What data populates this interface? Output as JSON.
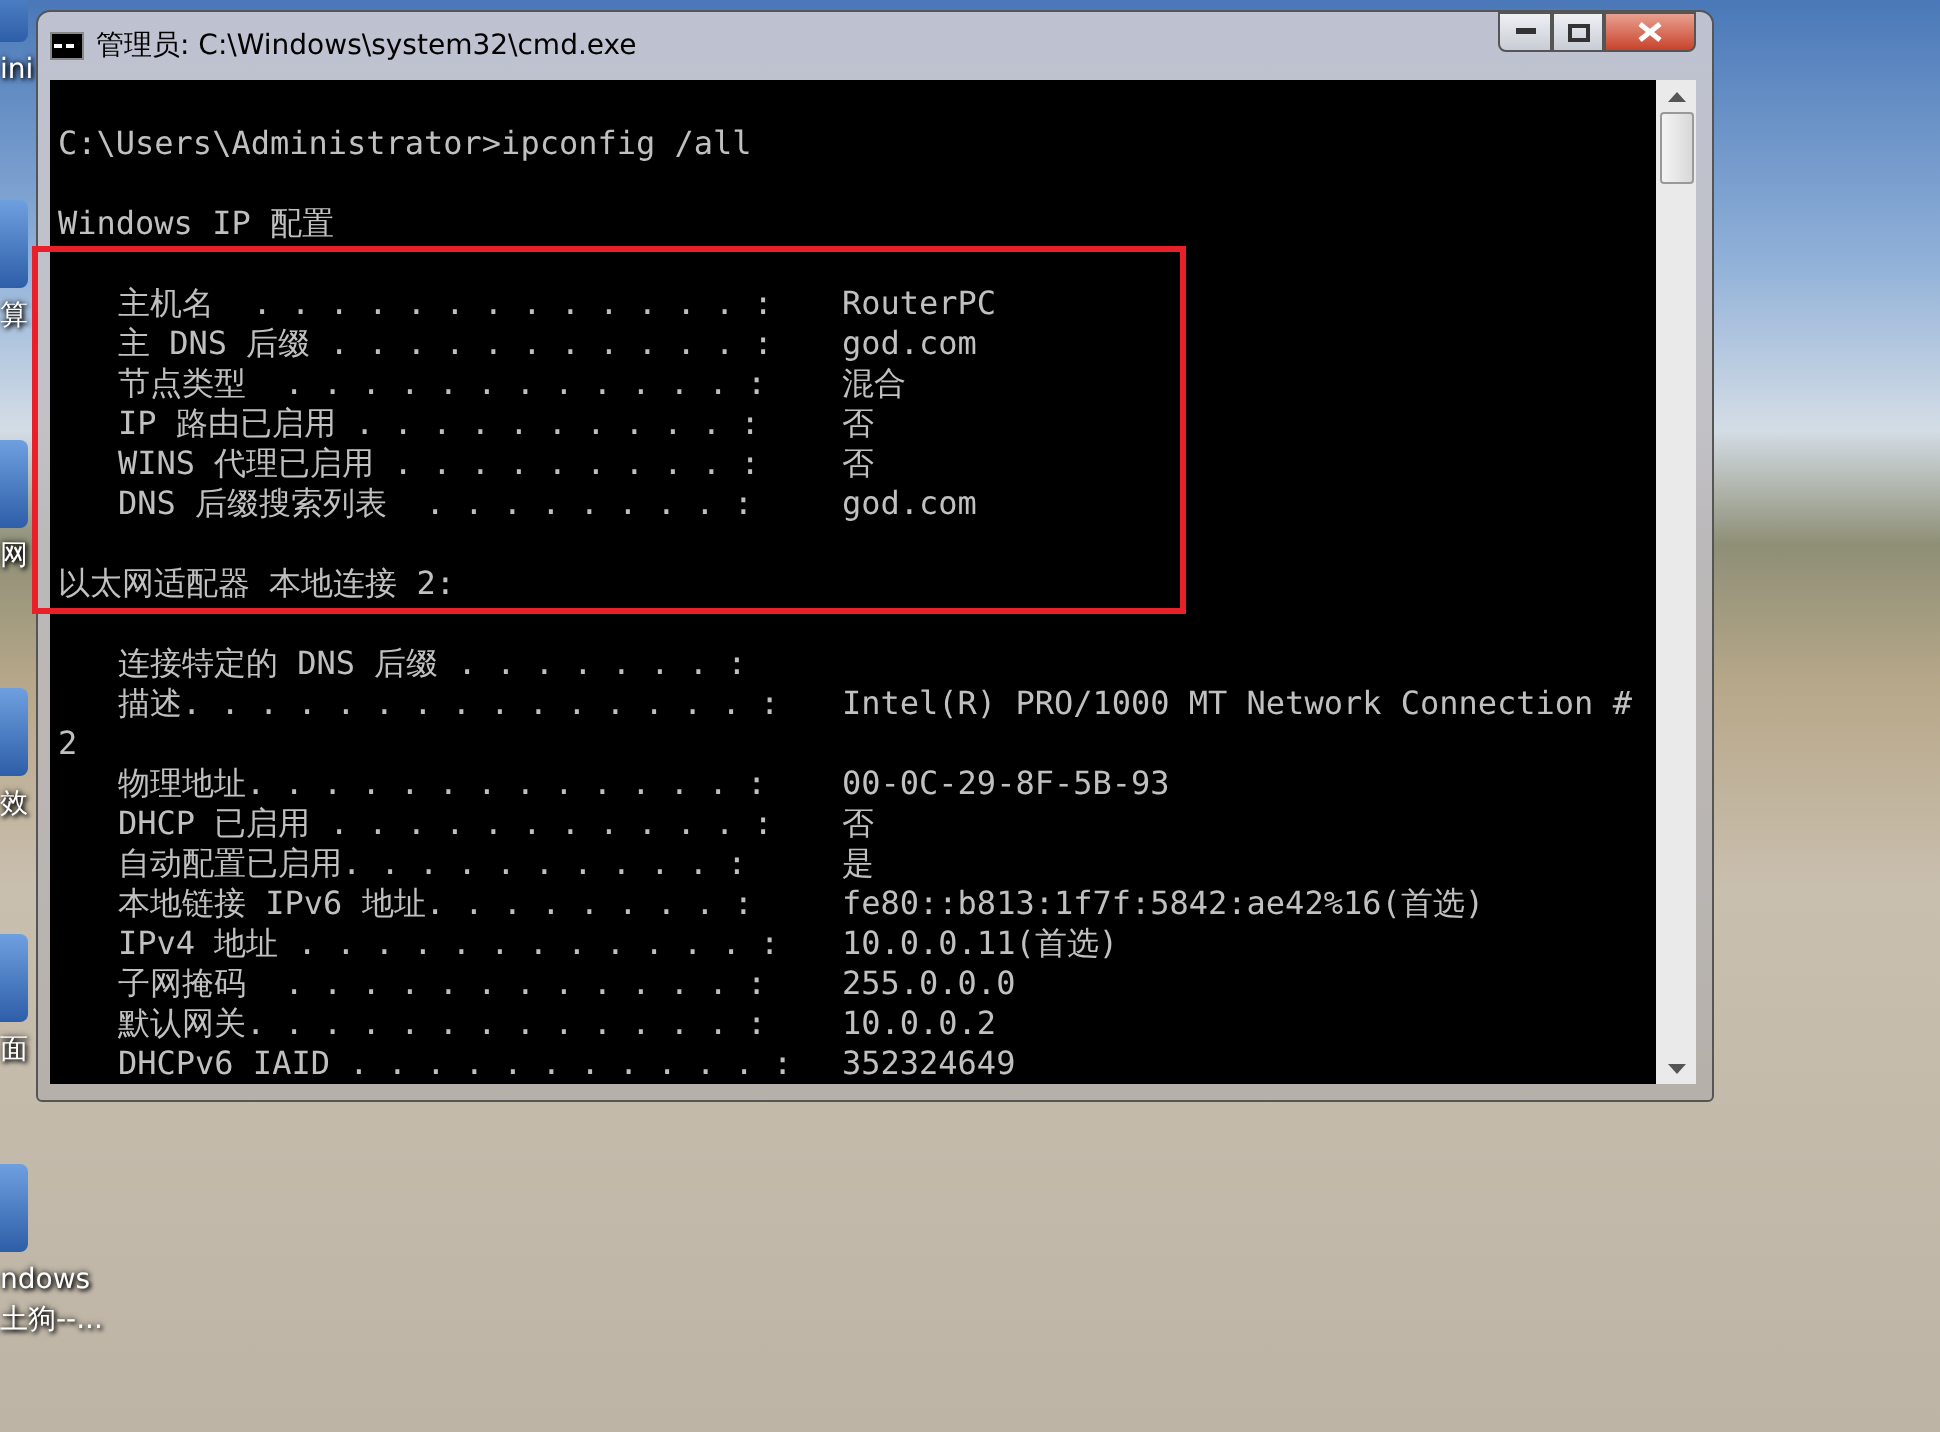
{
  "desktop_icons": [
    {
      "label": "ini"
    },
    {
      "label": "算"
    },
    {
      "label": "网"
    },
    {
      "label": "效"
    },
    {
      "label": "面"
    },
    {
      "label": "ndows\n土狗--..."
    }
  ],
  "window": {
    "title": "管理员: C:\\Windows\\system32\\cmd.exe"
  },
  "console_lines": [
    {
      "kind": "blank"
    },
    {
      "kind": "text",
      "text": "C:\\Users\\Administrator>ipconfig /all"
    },
    {
      "kind": "blank"
    },
    {
      "kind": "text",
      "text": "Windows IP 配置"
    },
    {
      "kind": "blank"
    },
    {
      "kind": "field",
      "label": "主机名  . . . . . . . . . . . . . :",
      "value": "RouterPC"
    },
    {
      "kind": "field",
      "label": "主 DNS 后缀 . . . . . . . . . . . :",
      "value": "god.com"
    },
    {
      "kind": "field",
      "label": "节点类型  . . . . . . . . . . . . :",
      "value": "混合"
    },
    {
      "kind": "field",
      "label": "IP 路由已启用 . . . . . . . . . . :",
      "value": "否"
    },
    {
      "kind": "field",
      "label": "WINS 代理已启用 . . . . . . . . . :",
      "value": "否"
    },
    {
      "kind": "field",
      "label": "DNS 后缀搜索列表  . . . . . . . . :",
      "value": "god.com"
    },
    {
      "kind": "blank"
    },
    {
      "kind": "text",
      "text": "以太网适配器 本地连接 2:"
    },
    {
      "kind": "blank"
    },
    {
      "kind": "field",
      "label": "连接特定的 DNS 后缀 . . . . . . . :"
    },
    {
      "kind": "field",
      "label": "描述. . . . . . . . . . . . . . . :",
      "value": "Intel(R) PRO/1000 MT Network Connection #"
    },
    {
      "kind": "text",
      "text": "2"
    },
    {
      "kind": "field",
      "label": "物理地址. . . . . . . . . . . . . :",
      "value": "00-0C-29-8F-5B-93"
    },
    {
      "kind": "field",
      "label": "DHCP 已启用 . . . . . . . . . . . :",
      "value": "否"
    },
    {
      "kind": "field",
      "label": "自动配置已启用. . . . . . . . . . :",
      "value": "是"
    },
    {
      "kind": "field",
      "label": "本地链接 IPv6 地址. . . . . . . . :",
      "value": "fe80::b813:1f7f:5842:ae42%16(首选)"
    },
    {
      "kind": "field",
      "label": "IPv4 地址 . . . . . . . . . . . . :",
      "value": "10.0.0.11(首选)"
    },
    {
      "kind": "field",
      "label": "子网掩码  . . . . . . . . . . . . :",
      "value": "255.0.0.0"
    },
    {
      "kind": "field",
      "label": "默认网关. . . . . . . . . . . . . :",
      "value": "10.0.0.2"
    },
    {
      "kind": "field",
      "label": "DHCPv6 IAID . . . . . . . . . . . :",
      "value": "352324649"
    }
  ]
}
